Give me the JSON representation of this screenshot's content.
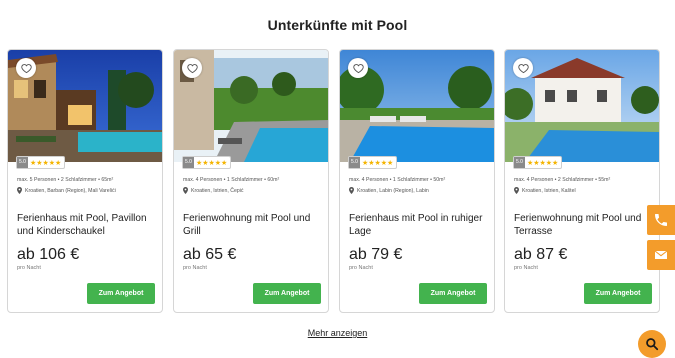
{
  "section_title": "Unterkünfte mit Pool",
  "cards": [
    {
      "rating_badge": "5.0",
      "stars": "★★★★★",
      "facts": "max. 5 Personen  •  2 Schlafzimmer  •  65m²",
      "location": "Kroatien, Barban (Region), Mali Varelići",
      "name": "Ferienhaus mit Pool, Pavillon und Kinderschaukel",
      "price": "ab 106 €",
      "per_night": "pro Nacht",
      "button": "Zum Angebot"
    },
    {
      "rating_badge": "5.0",
      "stars": "★★★★★",
      "facts": "max. 4 Personen  •  1 Schlafzimmer  •  60m²",
      "location": "Kroatien, Istrien, Čepić",
      "name": "Ferienwohnung mit Pool und Grill",
      "price": "ab 65 €",
      "per_night": "pro Nacht",
      "button": "Zum Angebot"
    },
    {
      "rating_badge": "5.0",
      "stars": "★★★★★",
      "facts": "max. 4 Personen  •  1 Schlafzimmer  •  50m²",
      "location": "Kroatien, Labin (Region), Labin",
      "name": "Ferienhaus mit Pool in ruhiger Lage",
      "price": "ab 79 €",
      "per_night": "pro Nacht",
      "button": "Zum Angebot"
    },
    {
      "rating_badge": "5.0",
      "stars": "★★★★★",
      "facts": "max. 4 Personen  •  2 Schlafzimmer  •  55m²",
      "location": "Kroatien, Istrien, Kaštel",
      "name": "Ferienwohnung mit Pool und Terrasse",
      "price": "ab 87 €",
      "per_night": "pro Nacht",
      "button": "Zum Angebot"
    }
  ],
  "more_link": "Mehr anzeigen",
  "icons": {
    "favorite": "heart-icon",
    "location": "map-pin-icon",
    "phone": "phone-icon",
    "email": "envelope-icon",
    "search": "search-icon"
  },
  "colors": {
    "button_green": "#43b34e",
    "accent_orange": "#f39c2b",
    "star_yellow": "#f4b400"
  }
}
